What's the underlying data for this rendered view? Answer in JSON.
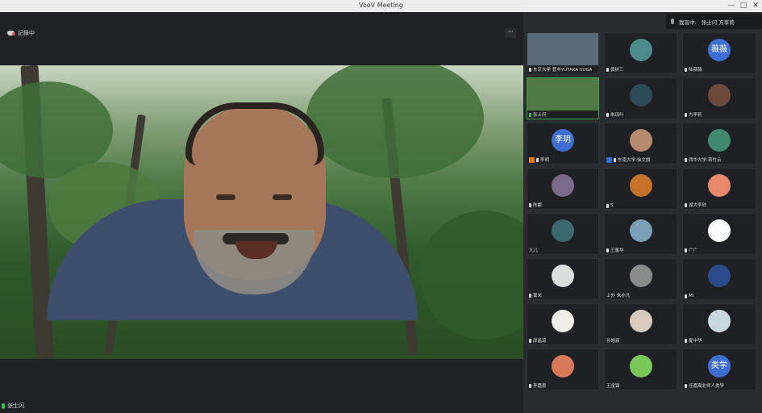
{
  "window": {
    "title": "VooV Meeting",
    "controls": [
      "—",
      "□",
      "✕"
    ]
  },
  "recording": {
    "label": "記錄中"
  },
  "main_speaker": {
    "name": "张士闪"
  },
  "topbar": {
    "speaking_label": "我盲中:",
    "speakers": "张士闪 方李莉"
  },
  "participants": [
    {
      "name": "东京大学 菅丰YUTAKA SUGA",
      "avatar": "video",
      "color": "#5a6a78",
      "mic": "off"
    },
    {
      "name": "黄树三",
      "avatar": "image",
      "color": "#4c8a8c",
      "mic": "off"
    },
    {
      "name": "陆薇薇",
      "avatar": "text",
      "avatar_text": "薇薇",
      "color": "#3f6ed3",
      "mic": "on"
    },
    {
      "name": "张士闪",
      "avatar": "video",
      "color": "#4f7a46",
      "mic": "talking",
      "active": true
    },
    {
      "name": "朱琼叶",
      "avatar": "image",
      "color": "#2d4a5a",
      "mic": "off"
    },
    {
      "name": "方李莉",
      "avatar": "image",
      "color": "#6b4a3a",
      "mic": "off"
    },
    {
      "name": "李明",
      "avatar": "text",
      "avatar_text": "李玥",
      "color": "#3f6ed3",
      "mic": "off",
      "host": "orange"
    },
    {
      "name": "东南大学-徐文旗",
      "avatar": "image",
      "color": "#b58a6e",
      "mic": "off",
      "host": "blue"
    },
    {
      "name": "西华大学-蒋竹云",
      "avatar": "image",
      "color": "#3f8a6e",
      "mic": "off"
    },
    {
      "name": "陈娜",
      "avatar": "image",
      "color": "#7a6a8c",
      "mic": "off"
    },
    {
      "name": "S",
      "avatar": "image",
      "color": "#c4722a",
      "mic": "off"
    },
    {
      "name": "湖大李欣",
      "avatar": "image",
      "color": "#e88a6a",
      "mic": "off"
    },
    {
      "name": "九儿",
      "avatar": "image",
      "color": "#3a6a6e",
      "mic": "none"
    },
    {
      "name": "王馨华",
      "avatar": "image",
      "color": "#7aa0b8",
      "mic": "off"
    },
    {
      "name": "广广",
      "avatar": "image",
      "color": "#ffffff",
      "mic": "off"
    },
    {
      "name": "繁米",
      "avatar": "image",
      "color": "#dddddd",
      "mic": "off"
    },
    {
      "name": "上外 朱亦凡",
      "avatar": "image",
      "color": "#8a8a8a",
      "mic": "none"
    },
    {
      "name": "MI",
      "avatar": "image",
      "color": "#2a4a8a",
      "mic": "off"
    },
    {
      "name": "邵晶琼",
      "avatar": "image",
      "color": "#f0eee8",
      "mic": "off"
    },
    {
      "name": "孙皓宸",
      "avatar": "image",
      "color": "#d8ccbc",
      "mic": "none"
    },
    {
      "name": "夏中华",
      "avatar": "image",
      "color": "#c8d8e0",
      "mic": "off"
    },
    {
      "name": "李嘉豪",
      "avatar": "image",
      "color": "#d87a5a",
      "mic": "off"
    },
    {
      "name": "王金锋",
      "avatar": "image",
      "color": "#7ac85a",
      "mic": "none"
    },
    {
      "name": "任嘉嵩北师人类学",
      "avatar": "text",
      "avatar_text": "类学",
      "color": "#3f6ed3",
      "mic": "on"
    }
  ]
}
